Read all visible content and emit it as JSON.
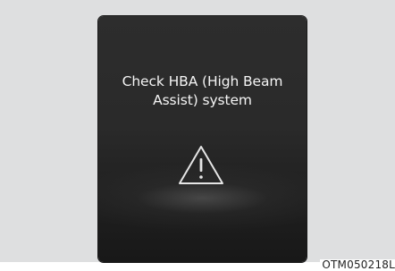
{
  "display": {
    "message_line_1": "Check HBA (High Beam",
    "message_line_2": "Assist) system",
    "icon": "warning-triangle-icon"
  },
  "figure": {
    "code": "OTM050218L"
  },
  "colors": {
    "screen_background": "#2a2a2a",
    "text": "#f4f4f4",
    "icon_stroke": "#e6e6e6",
    "figure_background": "#dedfe0"
  }
}
